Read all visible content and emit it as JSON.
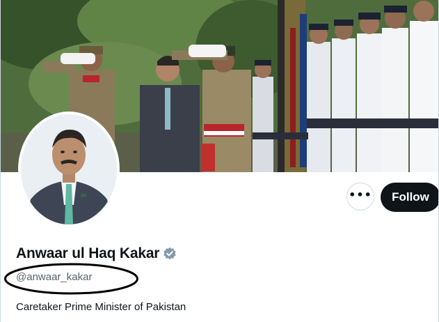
{
  "profile": {
    "display_name": "Anwaar ul Haq Kakar",
    "handle": "@anwaar_kakar",
    "bio": "Caretaker Prime Minister of Pakistan",
    "verified": true
  },
  "actions": {
    "more_label": "•••",
    "follow_label": "Follow"
  },
  "icons": {
    "verified": "verified-badge-icon",
    "more": "more-options-icon"
  },
  "colors": {
    "follow_bg": "#0f1419",
    "handle_text": "#536471",
    "verified_badge": "#829aab",
    "annotation_ellipse": "#000000"
  }
}
